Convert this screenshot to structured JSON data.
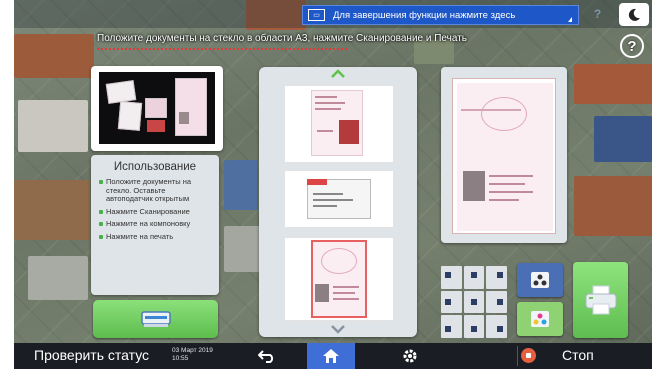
{
  "top_bar": {
    "mode_label": "Для завершения функции нажмите здесь",
    "mode_icon": "copy-mode-icon",
    "help_mini_label": "?",
    "night_icon": "moon-icon"
  },
  "instructions": {
    "text": "Положите документы на стекло в области А3, нажмите Сканирование и Печать"
  },
  "help_button_label": "?",
  "usage_panel": {
    "title": "Использование",
    "steps": [
      "Положите документы на стекло. Оставьте автоподатчик открытым",
      "Нажмите Сканирование",
      "Нажмите на компоновку",
      "Нажмите на печать"
    ]
  },
  "bottom_bar": {
    "status_label": "Проверить статус",
    "date": "03 Март 2019",
    "time": "10:55",
    "stop_label": "Стоп"
  },
  "colors": {
    "accent_blue": "#3f6ed6",
    "panel": "#dfe4e8",
    "green": "#6cc75a",
    "bar": "#1b1d24"
  }
}
